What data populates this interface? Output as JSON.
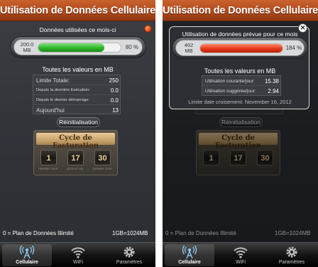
{
  "app_title": "Utilisation de Données Cellulaire",
  "main": {
    "data_used_label": "Données utilisées ce mois-ci",
    "gauge": {
      "value_mb": "200.0",
      "unit": "MB",
      "percent_label": "80 %",
      "fill_fraction": 0.8,
      "fill_color": "#2fb52a"
    },
    "values_caption": "Toutes les valeurs en MB",
    "stats": [
      {
        "label": "Limite Totale:",
        "value": "250"
      },
      {
        "label": "Depuis la dernière Exécution:",
        "value": "0.0"
      },
      {
        "label": "Depuis le dernier démarrage:",
        "value": "0.0"
      },
      {
        "label": "Aujourd'hui",
        "value": "13"
      }
    ],
    "reset_button": "Réinitialisation",
    "billing": {
      "title": "Cycle de Facturation",
      "values": [
        "1",
        "17",
        "30"
      ],
      "captions": [
        "PREMIER JOUR",
        "JOUR ACTUEL",
        "DERNIER JOUR"
      ]
    },
    "plan_text": "0 = Plan de Données Illimité",
    "gb_text": "1GB=1024MB"
  },
  "popup": {
    "title": "Utilisation de données prévue pour ce mois",
    "gauge": {
      "value_mb": "462",
      "unit": "MB",
      "percent_label": "184 %",
      "fill_fraction": 1.0,
      "fill_color": "#e5391a"
    },
    "values_caption": "Toutes les valeurs en MB",
    "stats": [
      {
        "label": "Utilisation courante/jour:",
        "value": "15.38"
      },
      {
        "label": "Utilisation suggérée/jour:",
        "value": "2.94"
      }
    ],
    "crossover_text": "Limite date croisement: November 16, 2012",
    "close_glyph": "✕"
  },
  "tabs": [
    {
      "label": "Cellulaire",
      "icon": "cell-tower-icon",
      "active": true
    },
    {
      "label": "WiFi",
      "icon": "wifi-icon",
      "active": false
    },
    {
      "label": "Paramètres",
      "icon": "gear-icon",
      "active": false
    }
  ],
  "colors": {
    "title_bar": "#b04a1c",
    "accent_green": "#2fb52a",
    "accent_red": "#e5391a",
    "billing_gold": "#c9a56e"
  }
}
